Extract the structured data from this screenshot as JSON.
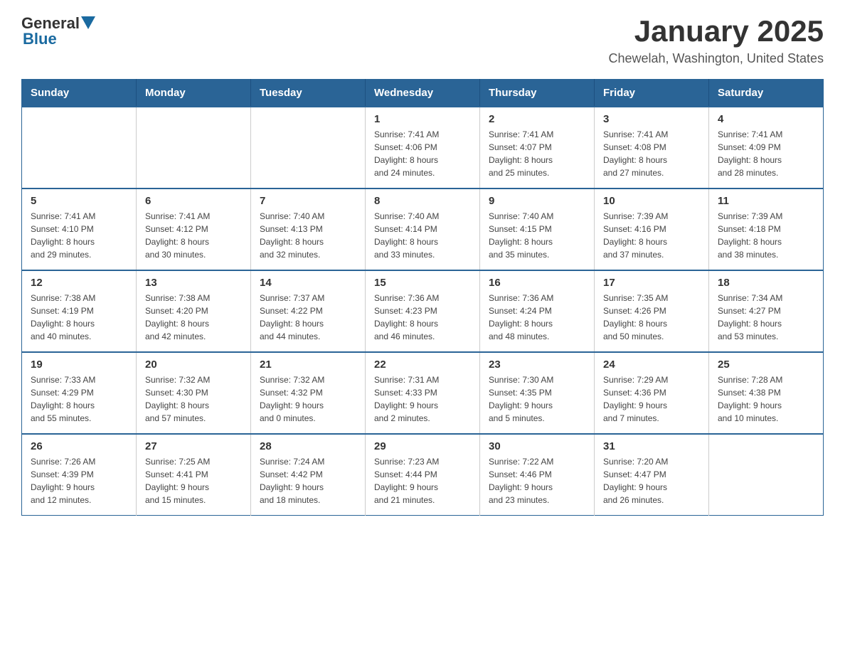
{
  "header": {
    "logo_general": "General",
    "logo_blue": "Blue",
    "title": "January 2025",
    "subtitle": "Chewelah, Washington, United States"
  },
  "calendar": {
    "days_of_week": [
      "Sunday",
      "Monday",
      "Tuesday",
      "Wednesday",
      "Thursday",
      "Friday",
      "Saturday"
    ],
    "weeks": [
      [
        {
          "day": "",
          "info": ""
        },
        {
          "day": "",
          "info": ""
        },
        {
          "day": "",
          "info": ""
        },
        {
          "day": "1",
          "info": "Sunrise: 7:41 AM\nSunset: 4:06 PM\nDaylight: 8 hours\nand 24 minutes."
        },
        {
          "day": "2",
          "info": "Sunrise: 7:41 AM\nSunset: 4:07 PM\nDaylight: 8 hours\nand 25 minutes."
        },
        {
          "day": "3",
          "info": "Sunrise: 7:41 AM\nSunset: 4:08 PM\nDaylight: 8 hours\nand 27 minutes."
        },
        {
          "day": "4",
          "info": "Sunrise: 7:41 AM\nSunset: 4:09 PM\nDaylight: 8 hours\nand 28 minutes."
        }
      ],
      [
        {
          "day": "5",
          "info": "Sunrise: 7:41 AM\nSunset: 4:10 PM\nDaylight: 8 hours\nand 29 minutes."
        },
        {
          "day": "6",
          "info": "Sunrise: 7:41 AM\nSunset: 4:12 PM\nDaylight: 8 hours\nand 30 minutes."
        },
        {
          "day": "7",
          "info": "Sunrise: 7:40 AM\nSunset: 4:13 PM\nDaylight: 8 hours\nand 32 minutes."
        },
        {
          "day": "8",
          "info": "Sunrise: 7:40 AM\nSunset: 4:14 PM\nDaylight: 8 hours\nand 33 minutes."
        },
        {
          "day": "9",
          "info": "Sunrise: 7:40 AM\nSunset: 4:15 PM\nDaylight: 8 hours\nand 35 minutes."
        },
        {
          "day": "10",
          "info": "Sunrise: 7:39 AM\nSunset: 4:16 PM\nDaylight: 8 hours\nand 37 minutes."
        },
        {
          "day": "11",
          "info": "Sunrise: 7:39 AM\nSunset: 4:18 PM\nDaylight: 8 hours\nand 38 minutes."
        }
      ],
      [
        {
          "day": "12",
          "info": "Sunrise: 7:38 AM\nSunset: 4:19 PM\nDaylight: 8 hours\nand 40 minutes."
        },
        {
          "day": "13",
          "info": "Sunrise: 7:38 AM\nSunset: 4:20 PM\nDaylight: 8 hours\nand 42 minutes."
        },
        {
          "day": "14",
          "info": "Sunrise: 7:37 AM\nSunset: 4:22 PM\nDaylight: 8 hours\nand 44 minutes."
        },
        {
          "day": "15",
          "info": "Sunrise: 7:36 AM\nSunset: 4:23 PM\nDaylight: 8 hours\nand 46 minutes."
        },
        {
          "day": "16",
          "info": "Sunrise: 7:36 AM\nSunset: 4:24 PM\nDaylight: 8 hours\nand 48 minutes."
        },
        {
          "day": "17",
          "info": "Sunrise: 7:35 AM\nSunset: 4:26 PM\nDaylight: 8 hours\nand 50 minutes."
        },
        {
          "day": "18",
          "info": "Sunrise: 7:34 AM\nSunset: 4:27 PM\nDaylight: 8 hours\nand 53 minutes."
        }
      ],
      [
        {
          "day": "19",
          "info": "Sunrise: 7:33 AM\nSunset: 4:29 PM\nDaylight: 8 hours\nand 55 minutes."
        },
        {
          "day": "20",
          "info": "Sunrise: 7:32 AM\nSunset: 4:30 PM\nDaylight: 8 hours\nand 57 minutes."
        },
        {
          "day": "21",
          "info": "Sunrise: 7:32 AM\nSunset: 4:32 PM\nDaylight: 9 hours\nand 0 minutes."
        },
        {
          "day": "22",
          "info": "Sunrise: 7:31 AM\nSunset: 4:33 PM\nDaylight: 9 hours\nand 2 minutes."
        },
        {
          "day": "23",
          "info": "Sunrise: 7:30 AM\nSunset: 4:35 PM\nDaylight: 9 hours\nand 5 minutes."
        },
        {
          "day": "24",
          "info": "Sunrise: 7:29 AM\nSunset: 4:36 PM\nDaylight: 9 hours\nand 7 minutes."
        },
        {
          "day": "25",
          "info": "Sunrise: 7:28 AM\nSunset: 4:38 PM\nDaylight: 9 hours\nand 10 minutes."
        }
      ],
      [
        {
          "day": "26",
          "info": "Sunrise: 7:26 AM\nSunset: 4:39 PM\nDaylight: 9 hours\nand 12 minutes."
        },
        {
          "day": "27",
          "info": "Sunrise: 7:25 AM\nSunset: 4:41 PM\nDaylight: 9 hours\nand 15 minutes."
        },
        {
          "day": "28",
          "info": "Sunrise: 7:24 AM\nSunset: 4:42 PM\nDaylight: 9 hours\nand 18 minutes."
        },
        {
          "day": "29",
          "info": "Sunrise: 7:23 AM\nSunset: 4:44 PM\nDaylight: 9 hours\nand 21 minutes."
        },
        {
          "day": "30",
          "info": "Sunrise: 7:22 AM\nSunset: 4:46 PM\nDaylight: 9 hours\nand 23 minutes."
        },
        {
          "day": "31",
          "info": "Sunrise: 7:20 AM\nSunset: 4:47 PM\nDaylight: 9 hours\nand 26 minutes."
        },
        {
          "day": "",
          "info": ""
        }
      ]
    ]
  }
}
